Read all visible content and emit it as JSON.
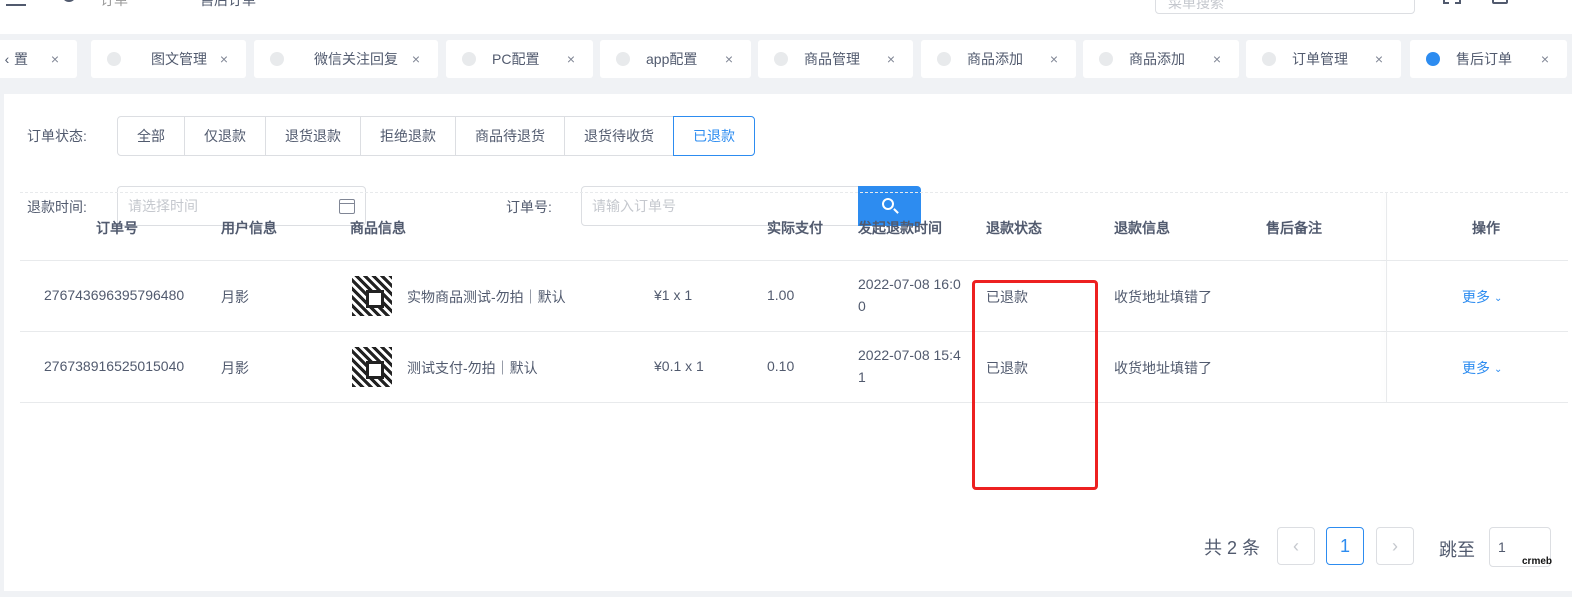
{
  "header": {
    "crumbs": [
      "订单",
      "售后订单"
    ],
    "search_placeholder": "菜单搜索"
  },
  "tabs": [
    {
      "label": "置",
      "active": false
    },
    {
      "label": "图文管理",
      "active": false
    },
    {
      "label": "微信关注回复",
      "active": false
    },
    {
      "label": "PC配置",
      "active": false
    },
    {
      "label": "app配置",
      "active": false
    },
    {
      "label": "商品管理",
      "active": false
    },
    {
      "label": "商品添加",
      "active": false
    },
    {
      "label": "商品添加",
      "active": false
    },
    {
      "label": "订单管理",
      "active": false
    },
    {
      "label": "售后订单",
      "active": true
    }
  ],
  "tab_close_symbol": "×",
  "filters": {
    "status_label": "订单状态:",
    "status_options": [
      "全部",
      "仅退款",
      "退货退款",
      "拒绝退款",
      "商品待退货",
      "退货待收货",
      "已退款"
    ],
    "status_selected": "已退款",
    "time_label": "退款时间:",
    "time_placeholder": "请选择时间",
    "order_label": "订单号:",
    "order_placeholder": "请输入订单号"
  },
  "table": {
    "columns": [
      "订单号",
      "用户信息",
      "商品信息",
      "实际支付",
      "发起退款时间",
      "退款状态",
      "退款信息",
      "售后备注",
      "操作"
    ],
    "rows": [
      {
        "order_no": "276743696395796480",
        "user": "月影",
        "product": "实物商品测试-勿拍｜默认",
        "qty_price": "¥1 x 1",
        "paid": "1.00",
        "refund_time_line1": "2022-07-08 16:0",
        "refund_time_line2": "0",
        "refund_status": "已退款",
        "refund_info": "收货地址填错了",
        "remark": "",
        "action": "更多"
      },
      {
        "order_no": "276738916525015040",
        "user": "月影",
        "product": "测试支付-勿拍｜默认",
        "qty_price": "¥0.1 x 1",
        "paid": "0.10",
        "refund_time_line1": "2022-07-08 15:4",
        "refund_time_line2": "1",
        "refund_status": "已退款",
        "refund_info": "收货地址填错了",
        "remark": "",
        "action": "更多"
      }
    ]
  },
  "pagination": {
    "total_text": "共 2 条",
    "prev": "‹",
    "current": "1",
    "next": "›",
    "jump_label": "跳至",
    "jump_value": "1"
  },
  "watermark": "crmeb",
  "colors": {
    "primary": "#2d8cf0",
    "highlight": "#ed2020"
  },
  "icons": {
    "menu": "hamburger",
    "refresh": "refresh",
    "calendar": "calendar",
    "search": "magnifier",
    "chevron": "chevron-down"
  }
}
